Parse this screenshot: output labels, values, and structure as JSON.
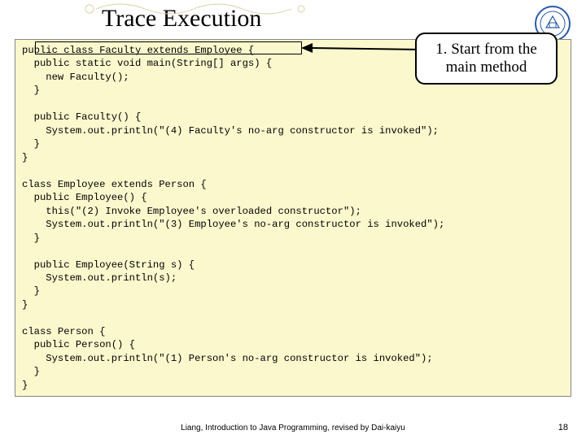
{
  "title": "Trace Execution",
  "callout": "1. Start from the main method",
  "code": "public class Faculty extends Employee {\n  public static void main(String[] args) {\n    new Faculty();\n  }\n\n  public Faculty() {\n    System.out.println(\"(4) Faculty's no-arg constructor is invoked\");\n  }\n}\n\nclass Employee extends Person {\n  public Employee() {\n    this(\"(2) Invoke Employee's overloaded constructor\");\n    System.out.println(\"(3) Employee's no-arg constructor is invoked\");\n  }\n\n  public Employee(String s) {\n    System.out.println(s);\n  }\n}\n\nclass Person {\n  public Person() {\n    System.out.println(\"(1) Person's no-arg constructor is invoked\");\n  }\n}",
  "footer": "Liang, Introduction to Java Programming, revised by Dai-kaiyu",
  "page": "18"
}
